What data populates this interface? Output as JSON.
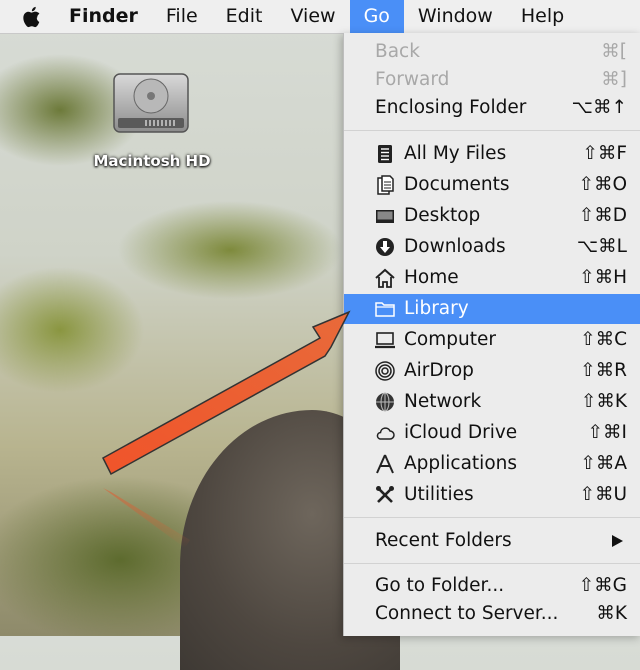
{
  "menubar": {
    "apple_icon": "apple-logo-icon",
    "items": [
      "Finder",
      "File",
      "Edit",
      "View",
      "Go",
      "Window",
      "Help"
    ],
    "active": "Go"
  },
  "desktop": {
    "drive_label": "Macintosh HD",
    "drive_icon": "hard-drive-icon"
  },
  "go_menu": {
    "back": {
      "label": "Back",
      "shortcut": "⌘["
    },
    "forward": {
      "label": "Forward",
      "shortcut": "⌘]"
    },
    "enclosing": {
      "label": "Enclosing Folder",
      "shortcut": "⌥⌘↑"
    },
    "all_my_files": {
      "label": "All My Files",
      "shortcut": "⇧⌘F",
      "icon": "all-my-files-icon"
    },
    "documents": {
      "label": "Documents",
      "shortcut": "⇧⌘O",
      "icon": "documents-icon"
    },
    "desktop": {
      "label": "Desktop",
      "shortcut": "⇧⌘D",
      "icon": "desktop-icon"
    },
    "downloads": {
      "label": "Downloads",
      "shortcut": "⌥⌘L",
      "icon": "downloads-icon"
    },
    "home": {
      "label": "Home",
      "shortcut": "⇧⌘H",
      "icon": "home-icon"
    },
    "library": {
      "label": "Library",
      "icon": "folder-icon"
    },
    "computer": {
      "label": "Computer",
      "shortcut": "⇧⌘C",
      "icon": "computer-icon"
    },
    "airdrop": {
      "label": "AirDrop",
      "shortcut": "⇧⌘R",
      "icon": "airdrop-icon"
    },
    "network": {
      "label": "Network",
      "shortcut": "⇧⌘K",
      "icon": "network-icon"
    },
    "icloud": {
      "label": "iCloud Drive",
      "shortcut": "⇧⌘I",
      "icon": "cloud-icon"
    },
    "applications": {
      "label": "Applications",
      "shortcut": "⇧⌘A",
      "icon": "applications-icon"
    },
    "utilities": {
      "label": "Utilities",
      "shortcut": "⇧⌘U",
      "icon": "utilities-icon"
    },
    "recent": {
      "label": "Recent Folders"
    },
    "go_to_folder": {
      "label": "Go to Folder...",
      "shortcut": "⇧⌘G"
    },
    "connect": {
      "label": "Connect to Server...",
      "shortcut": "⌘K"
    }
  },
  "colors": {
    "highlight": "#4a8ff7",
    "menu_bg": "#ececec",
    "annotation_arrow": "#e8552a"
  }
}
